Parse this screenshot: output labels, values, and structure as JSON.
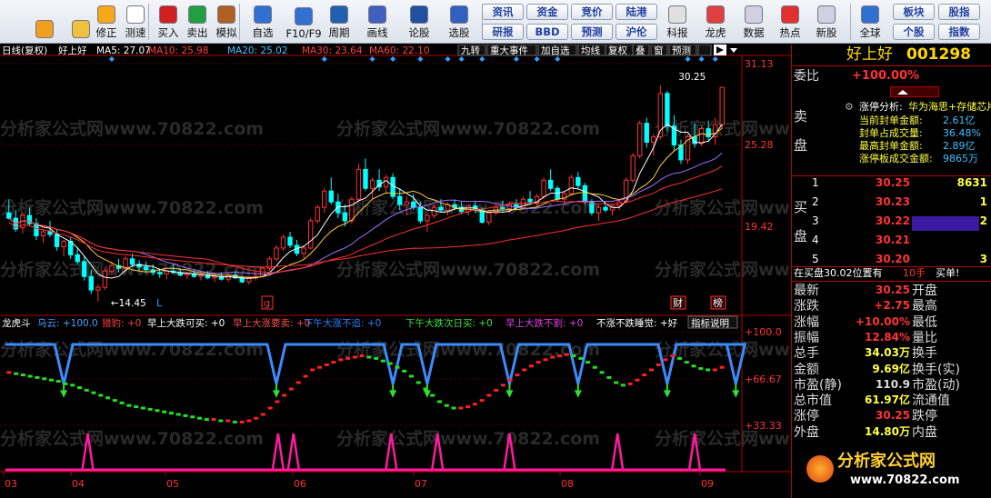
{
  "toolbar": {
    "left_buttons": [
      {
        "label": "",
        "icon": "back-arrow-icon"
      },
      {
        "label": "",
        "icon": "up-down-arrows-icon"
      },
      {
        "label": "修正",
        "icon": "fix-icon"
      },
      {
        "label": "测速",
        "icon": "clock-icon"
      },
      {
        "label": "买入",
        "icon": "buy-icon"
      },
      {
        "label": "卖出",
        "icon": "sell-icon"
      },
      {
        "label": "模拟",
        "icon": "hammer-icon"
      },
      {
        "label": "自选",
        "icon": "star-folder-icon"
      },
      {
        "label": "F10/F9",
        "icon": "f10-icon"
      },
      {
        "label": "周期",
        "icon": "period-icon"
      },
      {
        "label": "画线",
        "icon": "draw-line-icon"
      },
      {
        "label": "论股",
        "icon": "forum-icon"
      },
      {
        "label": "选股",
        "icon": "stock-picker-icon"
      }
    ],
    "grid_buttons": [
      "资讯",
      "资金",
      "竞价",
      "陆港",
      "研报",
      "BBD",
      "预测",
      "沪伦"
    ],
    "right_buttons": [
      {
        "label": "科报",
        "icon": "research-icon"
      },
      {
        "label": "龙虎",
        "icon": "dragon-tiger-icon"
      },
      {
        "label": "数据",
        "icon": "pe-data-icon"
      },
      {
        "label": "热点",
        "icon": "hot-icon"
      },
      {
        "label": "新股",
        "icon": "ipo-icon"
      },
      {
        "label": "全球",
        "icon": "globe-icon"
      }
    ],
    "far_right_buttons": [
      "板块",
      "股指",
      "个股",
      "指数"
    ]
  },
  "chart_header": {
    "mode": "日线(复权)",
    "stock_name": "好上好",
    "ma5": "MA5: 27.07",
    "ma10": "MA10: 25.98",
    "ma20": "MA20: 25.02",
    "ma30": "MA30: 23.64",
    "ma60": "MA60: 22.10",
    "menu": [
      "九转",
      "重大事件",
      "加自选",
      "均线",
      "复权",
      "叠",
      "窗",
      "预测"
    ]
  },
  "price_axis": [
    "31.13",
    "25.28",
    "19.42"
  ],
  "high_label": "30.25",
  "low_label": "14.45",
  "marks": {
    "l1": "L",
    "l2": "L",
    "g": "g",
    "cai": "财",
    "bang": "榜"
  },
  "indicator_header": {
    "name": "龙虎斗",
    "items": [
      {
        "text": "乌云: +100.0",
        "color": "#4aa0ff"
      },
      {
        "text": "猎豹: +0",
        "color": "#ff4040"
      },
      {
        "text": "早上大跌可买: +0",
        "color": "#ffffff"
      },
      {
        "text": "早上大涨要卖: +0",
        "color": "#ff5050"
      },
      {
        "text": "下午大涨不追: +0",
        "color": "#3080ff"
      },
      {
        "text": "下午大跌次日买: +0",
        "color": "#40e040"
      },
      {
        "text": "早上大跌不割: +0",
        "color": "#e040e0"
      },
      {
        "text": "不涨不跌睡觉: +好",
        "color": "#ffffff"
      }
    ],
    "help": "指标说明"
  },
  "indicator_axis": [
    "+100.0",
    "+66.67",
    "+33.33"
  ],
  "x_axis": [
    "03",
    "04",
    "05",
    "06",
    "07",
    "08",
    "09"
  ],
  "watermark": "分析家公式网www.70822.com",
  "side": {
    "title": "好上好",
    "code": "001298",
    "weibi_label": "委比",
    "weibi_value": "+100.00%",
    "analysis_title": "涨停分析:",
    "analysis_tag": "华为海思+存储芯片",
    "analysis": [
      {
        "k": "当前封单金额:",
        "v": "2.61亿"
      },
      {
        "k": "封单占成交量:",
        "v": "36.48%"
      },
      {
        "k": "最高封单金额:",
        "v": "2.89亿"
      },
      {
        "k": "涨停板成交金额:",
        "v": "9865万"
      }
    ],
    "sell_label": "卖盘",
    "buy_label": "买盘",
    "buy_rows": [
      {
        "n": "1",
        "p": "30.25",
        "v": "8631"
      },
      {
        "n": "2",
        "p": "30.23",
        "v": "1"
      },
      {
        "n": "3",
        "p": "30.22",
        "v": "2"
      },
      {
        "n": "4",
        "p": "30.21",
        "v": ""
      },
      {
        "n": "5",
        "p": "30.20",
        "v": "3"
      }
    ],
    "status_left": "在买盘30.02位置有",
    "status_qty": "10手",
    "status_right": "买单!",
    "quote_rows": [
      {
        "l": "最新",
        "lv": "30.25",
        "r": "开盘",
        "rv": ""
      },
      {
        "l": "涨跌",
        "lv": "+2.75",
        "r": "最高",
        "rv": ""
      },
      {
        "l": "涨幅",
        "lv": "+10.00%",
        "r": "最低",
        "rv": ""
      },
      {
        "l": "振幅",
        "lv": "12.84%",
        "r": "量比",
        "rv": ""
      },
      {
        "l": "总手",
        "lv": "34.03万",
        "r": "换手",
        "rv": ""
      },
      {
        "l": "金额",
        "lv": "9.69亿",
        "r": "换手(实)",
        "rv": ""
      },
      {
        "l": "市盈(静)",
        "lv": "110.9",
        "r": "市盈(动)",
        "rv": ""
      },
      {
        "l": "总市值",
        "lv": "61.97亿",
        "r": "流通值",
        "rv": ""
      },
      {
        "l": "涨停",
        "lv": "30.25",
        "r": "跌停",
        "rv": ""
      },
      {
        "l": "外盘",
        "lv": "14.80万",
        "r": "内盘",
        "rv": ""
      }
    ],
    "logo_text": "分析家公式网",
    "logo_url": "www.70822.com"
  },
  "chart_data": {
    "type": "candlestick",
    "price_ylim": [
      13.5,
      32.0
    ],
    "indicator_ylim": [
      0,
      110
    ],
    "candles_ohlc": [
      [
        21.0,
        22.0,
        20.5,
        20.6
      ],
      [
        20.6,
        21.2,
        19.6,
        19.8
      ],
      [
        19.9,
        21.0,
        19.5,
        20.8
      ],
      [
        20.8,
        21.4,
        20.0,
        20.2
      ],
      [
        20.2,
        20.6,
        19.0,
        19.3
      ],
      [
        19.3,
        19.8,
        18.8,
        19.6
      ],
      [
        19.6,
        20.4,
        19.2,
        19.4
      ],
      [
        19.4,
        19.8,
        18.2,
        18.5
      ],
      [
        18.5,
        19.0,
        17.8,
        18.9
      ],
      [
        18.9,
        19.2,
        17.6,
        17.9
      ],
      [
        17.9,
        18.4,
        17.2,
        17.4
      ],
      [
        17.4,
        17.8,
        16.0,
        16.3
      ],
      [
        16.3,
        16.8,
        15.0,
        15.3
      ],
      [
        15.3,
        15.7,
        14.45,
        15.5
      ],
      [
        15.5,
        16.9,
        15.3,
        16.7
      ],
      [
        16.7,
        17.4,
        16.4,
        17.1
      ],
      [
        17.1,
        17.6,
        16.6,
        16.9
      ],
      [
        16.9,
        17.8,
        16.6,
        17.6
      ],
      [
        17.6,
        18.0,
        17.0,
        17.2
      ],
      [
        17.2,
        17.5,
        16.7,
        17.0
      ],
      [
        17.0,
        17.4,
        16.6,
        16.8
      ],
      [
        16.8,
        17.2,
        16.4,
        16.6
      ],
      [
        16.6,
        16.9,
        16.2,
        16.5
      ],
      [
        16.5,
        16.8,
        16.1,
        16.7
      ],
      [
        16.7,
        17.2,
        16.5,
        16.6
      ],
      [
        16.6,
        16.9,
        16.3,
        16.4
      ],
      [
        16.4,
        16.7,
        16.1,
        16.5
      ],
      [
        16.5,
        16.8,
        16.2,
        16.3
      ],
      [
        16.3,
        16.6,
        16.0,
        16.4
      ],
      [
        16.4,
        16.7,
        16.1,
        16.2
      ],
      [
        16.2,
        16.5,
        15.9,
        16.3
      ],
      [
        16.3,
        16.6,
        16.0,
        16.1
      ],
      [
        16.1,
        16.5,
        15.9,
        16.4
      ],
      [
        16.4,
        16.7,
        16.1,
        16.2
      ],
      [
        16.2,
        16.4,
        15.8,
        15.9
      ],
      [
        15.9,
        16.3,
        15.7,
        16.2
      ],
      [
        16.2,
        16.6,
        16.0,
        16.3
      ],
      [
        16.3,
        17.0,
        16.2,
        16.9
      ],
      [
        16.9,
        17.8,
        16.7,
        17.6
      ],
      [
        17.6,
        18.6,
        17.4,
        18.4
      ],
      [
        18.4,
        19.4,
        18.2,
        19.2
      ],
      [
        19.2,
        19.6,
        18.4,
        18.6
      ],
      [
        18.6,
        19.0,
        17.8,
        18.0
      ],
      [
        18.0,
        18.6,
        17.6,
        18.4
      ],
      [
        18.4,
        20.6,
        18.3,
        20.4
      ],
      [
        20.4,
        21.6,
        20.2,
        21.4
      ],
      [
        21.4,
        22.8,
        21.0,
        22.6
      ],
      [
        22.6,
        23.6,
        21.6,
        21.8
      ],
      [
        21.8,
        22.4,
        20.6,
        21.0
      ],
      [
        21.0,
        21.6,
        20.0,
        20.4
      ],
      [
        20.4,
        22.2,
        20.2,
        22.0
      ],
      [
        22.0,
        24.6,
        21.8,
        24.2
      ],
      [
        24.2,
        25.0,
        22.6,
        22.8
      ],
      [
        22.8,
        23.6,
        22.0,
        23.4
      ],
      [
        23.4,
        24.2,
        22.6,
        22.9
      ],
      [
        22.9,
        23.8,
        22.4,
        23.6
      ],
      [
        23.6,
        23.9,
        22.0,
        22.2
      ],
      [
        22.2,
        22.8,
        21.2,
        21.6
      ],
      [
        21.6,
        22.2,
        20.8,
        21.8
      ],
      [
        21.8,
        22.4,
        21.2,
        21.4
      ],
      [
        21.4,
        21.8,
        20.2,
        20.4
      ],
      [
        20.4,
        21.0,
        19.6,
        20.8
      ],
      [
        20.8,
        21.6,
        20.6,
        21.4
      ],
      [
        21.4,
        22.0,
        21.0,
        21.2
      ],
      [
        21.2,
        21.8,
        20.8,
        21.6
      ],
      [
        21.6,
        22.0,
        21.2,
        21.4
      ],
      [
        21.4,
        21.8,
        20.9,
        21.1
      ],
      [
        21.1,
        21.6,
        20.8,
        21.5
      ],
      [
        21.5,
        21.8,
        21.0,
        21.2
      ],
      [
        21.2,
        21.4,
        20.2,
        20.3
      ],
      [
        20.3,
        21.2,
        20.1,
        21.0
      ],
      [
        21.0,
        21.6,
        20.8,
        21.4
      ],
      [
        21.4,
        21.9,
        21.1,
        21.3
      ],
      [
        21.3,
        21.8,
        21.0,
        21.6
      ],
      [
        21.6,
        22.0,
        21.2,
        21.4
      ],
      [
        21.4,
        22.2,
        21.3,
        22.0
      ],
      [
        22.0,
        22.6,
        21.6,
        21.8
      ],
      [
        21.8,
        22.4,
        21.5,
        22.2
      ],
      [
        22.2,
        23.6,
        22.0,
        23.4
      ],
      [
        23.4,
        24.2,
        22.6,
        22.8
      ],
      [
        22.8,
        23.0,
        21.8,
        22.0
      ],
      [
        22.0,
        22.6,
        21.6,
        22.4
      ],
      [
        22.4,
        23.8,
        22.3,
        23.6
      ],
      [
        23.6,
        24.0,
        22.8,
        23.0
      ],
      [
        23.0,
        23.2,
        21.6,
        21.8
      ],
      [
        21.8,
        22.0,
        20.8,
        21.0
      ],
      [
        21.0,
        21.6,
        20.4,
        21.4
      ],
      [
        21.4,
        21.8,
        21.0,
        21.2
      ],
      [
        21.2,
        21.6,
        20.8,
        21.5
      ],
      [
        21.5,
        22.0,
        21.2,
        21.8
      ],
      [
        21.8,
        23.6,
        21.7,
        23.4
      ],
      [
        23.4,
        25.4,
        23.2,
        25.2
      ],
      [
        25.2,
        27.8,
        25.0,
        27.6
      ],
      [
        27.6,
        28.0,
        25.8,
        26.2
      ],
      [
        26.2,
        26.8,
        25.2,
        26.6
      ],
      [
        26.6,
        30.4,
        26.4,
        29.8
      ],
      [
        29.8,
        30.0,
        27.0,
        27.4
      ],
      [
        27.4,
        28.2,
        25.6,
        26.0
      ],
      [
        26.0,
        26.4,
        24.6,
        24.9
      ],
      [
        24.9,
        26.8,
        24.6,
        26.6
      ],
      [
        26.6,
        27.6,
        25.8,
        26.1
      ],
      [
        26.1,
        27.4,
        25.9,
        27.2
      ],
      [
        27.2,
        27.8,
        26.2,
        26.6
      ],
      [
        26.6,
        28.0,
        26.0,
        27.5
      ],
      [
        27.5,
        30.25,
        27.2,
        30.25
      ]
    ],
    "indicator_values": [
      78,
      77,
      76,
      75,
      74,
      73,
      72,
      71,
      69,
      68,
      66,
      64,
      62,
      60,
      58,
      56,
      54,
      52,
      51,
      50,
      49,
      48,
      47,
      46,
      45,
      44,
      43,
      42,
      41,
      41,
      40,
      40,
      39,
      39,
      40,
      42,
      45,
      50,
      55,
      60,
      65,
      70,
      75,
      80,
      82,
      84,
      86,
      88,
      89,
      90,
      91,
      90,
      89,
      87,
      85,
      82,
      79,
      75,
      70,
      65,
      60,
      55,
      52,
      50,
      50,
      51,
      53,
      56,
      60,
      64,
      68,
      72,
      76,
      80,
      83,
      86,
      88,
      90,
      91,
      92,
      91,
      89,
      86,
      82,
      78,
      74,
      70,
      68,
      69,
      72,
      76,
      80,
      84,
      88,
      91,
      89,
      86,
      83,
      81,
      80,
      80,
      82
    ],
    "signal_bars": [
      8,
      39,
      56,
      61,
      73,
      83,
      96,
      106
    ],
    "peak_bars": [
      16,
      53,
      56,
      75,
      84,
      98,
      119,
      134
    ]
  }
}
